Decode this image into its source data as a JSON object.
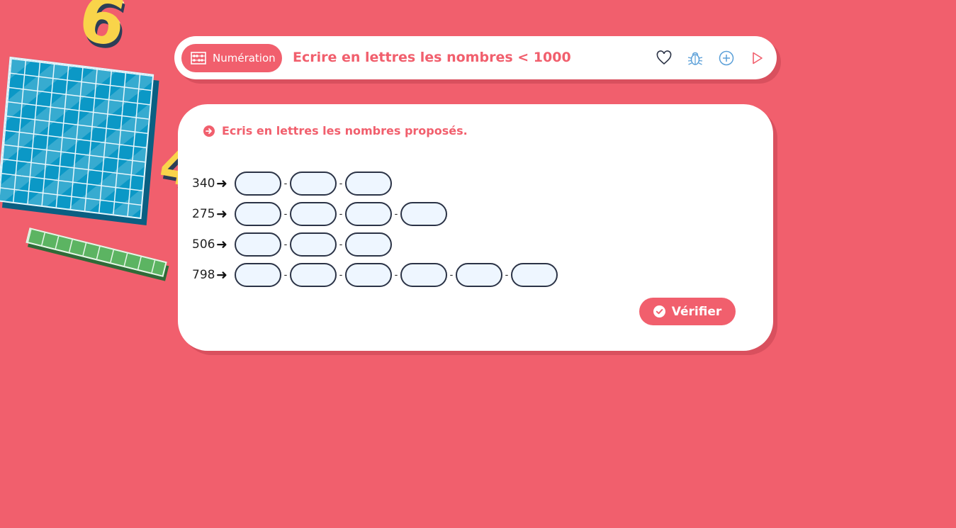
{
  "colors": {
    "background": "#f15f6d",
    "accent": "#f15f6d",
    "input_fill": "#eef6ff"
  },
  "topbar": {
    "topic_label": "Numération",
    "topic_icon": "abacus-icon",
    "lesson_title": "Ecrire en lettres les nombres < 1000",
    "tools": [
      "heart-icon",
      "bug-icon",
      "plus-circle-icon",
      "play-icon"
    ]
  },
  "exercise": {
    "instruction": "Ecris en lettres les nombres proposés.",
    "arrow_symbol": "➜",
    "separator": "-",
    "rows": [
      {
        "number": "340",
        "blanks": 3
      },
      {
        "number": "275",
        "blanks": 4
      },
      {
        "number": "506",
        "blanks": 3
      },
      {
        "number": "798",
        "blanks": 6
      }
    ],
    "verify_label": "Vérifier"
  },
  "decorations": {
    "digit_a": "6",
    "digit_b": "4"
  }
}
